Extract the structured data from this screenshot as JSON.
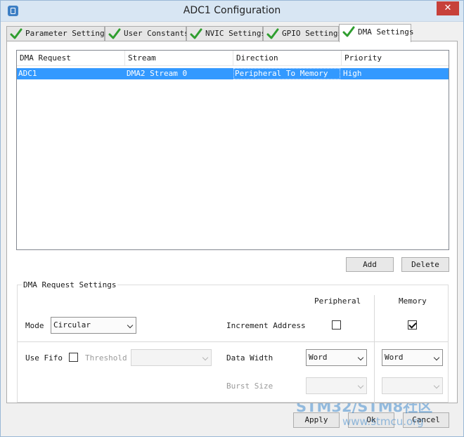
{
  "window": {
    "title": "ADC1 Configuration",
    "close_glyph": "✕"
  },
  "tabs": [
    {
      "label": "Parameter Settings",
      "icon": "checkmark-icon"
    },
    {
      "label": "User Constants",
      "icon": "checkmark-icon"
    },
    {
      "label": "NVIC Settings",
      "icon": "checkmark-icon"
    },
    {
      "label": "GPIO Settings",
      "icon": "checkmark-icon"
    },
    {
      "label": "DMA Settings",
      "icon": "checkmark-icon",
      "active": true
    }
  ],
  "colors": {
    "check_green": "#2f9e2f",
    "selection_blue": "#3399ff",
    "close_red": "#c7413a"
  },
  "dma_table": {
    "columns": [
      "DMA Request",
      "Stream",
      "Direction",
      "Priority"
    ],
    "rows": [
      [
        "ADC1",
        "DMA2 Stream 0",
        "Peripheral To Memory",
        "High"
      ]
    ]
  },
  "buttons": {
    "add": "Add",
    "delete": "Delete",
    "apply": "Apply",
    "ok": "Ok",
    "cancel": "Cancel"
  },
  "request_settings": {
    "title": "DMA Request Settings",
    "peripheral_header": "Peripheral",
    "memory_header": "Memory",
    "mode_label": "Mode",
    "mode_value": "Circular",
    "increment_label": "Increment Address",
    "increment_peripheral": false,
    "increment_memory": true,
    "use_fifo_label": "Use Fifo",
    "use_fifo": false,
    "threshold_label": "Threshold",
    "threshold_value": "",
    "data_width_label": "Data Width",
    "data_width_peripheral": "Word",
    "data_width_memory": "Word",
    "burst_size_label": "Burst Size",
    "burst_peripheral": "",
    "burst_memory": ""
  },
  "watermark": {
    "text": "STM32/STM8社区",
    "url": "www.stmcu.org"
  }
}
